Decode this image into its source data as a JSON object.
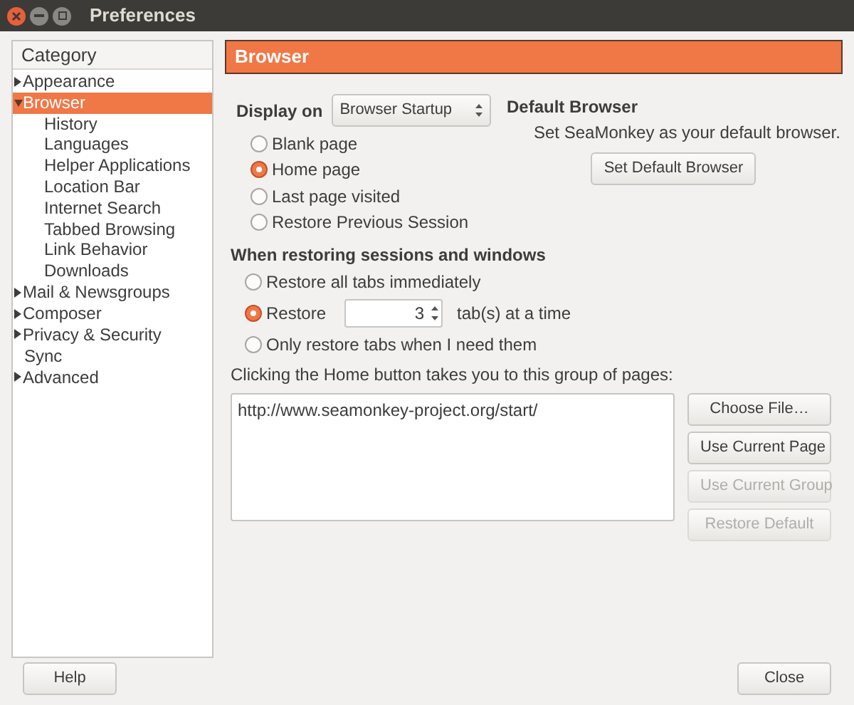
{
  "window": {
    "title": "Preferences"
  },
  "sidebar": {
    "header": "Category",
    "items": [
      {
        "label": "Appearance",
        "expandable": true,
        "expanded": false,
        "selected": false
      },
      {
        "label": "Browser",
        "expandable": true,
        "expanded": true,
        "selected": true,
        "children": [
          {
            "label": "History",
            "selected": false
          },
          {
            "label": "Languages",
            "selected": false
          },
          {
            "label": "Helper Applications",
            "selected": false
          },
          {
            "label": "Location Bar",
            "selected": false
          },
          {
            "label": "Internet Search",
            "selected": false
          },
          {
            "label": "Tabbed Browsing",
            "selected": false
          },
          {
            "label": "Link Behavior",
            "selected": false
          },
          {
            "label": "Downloads",
            "selected": false
          }
        ]
      },
      {
        "label": "Mail & Newsgroups",
        "expandable": true,
        "expanded": false,
        "selected": false
      },
      {
        "label": "Composer",
        "expandable": true,
        "expanded": false,
        "selected": false
      },
      {
        "label": "Privacy & Security",
        "expandable": true,
        "expanded": false,
        "selected": false
      },
      {
        "label": "Sync",
        "expandable": false,
        "selected": false
      },
      {
        "label": "Advanced",
        "expandable": true,
        "expanded": false,
        "selected": false
      }
    ]
  },
  "panel": {
    "title": "Browser",
    "display_on": {
      "label": "Display on",
      "value": "Browser Startup"
    },
    "startup_options": [
      {
        "label": "Blank page",
        "selected": false
      },
      {
        "label": "Home page",
        "selected": true
      },
      {
        "label": "Last page visited",
        "selected": false
      },
      {
        "label": "Restore Previous Session",
        "selected": false
      }
    ],
    "default_browser": {
      "heading": "Default Browser",
      "text": "Set SeaMonkey as your default browser.",
      "button": "Set Default Browser"
    },
    "restore_heading": "When restoring sessions and windows",
    "restore_options": [
      {
        "kind": "plain",
        "label": "Restore all tabs immediately",
        "selected": false
      },
      {
        "kind": "spin",
        "label": "Restore",
        "value": "3",
        "suffix": "tab(s) at a time",
        "selected": true
      },
      {
        "kind": "plain",
        "label": "Only restore tabs when I need them",
        "selected": false
      }
    ],
    "home_label": "Clicking the Home button takes you to this group of pages:",
    "home_pages": "http://www.seamonkey-project.org/start/",
    "home_buttons": [
      {
        "label": "Choose File…",
        "disabled": false
      },
      {
        "label": "Use Current Page",
        "disabled": false
      },
      {
        "label": "Use Current Group",
        "disabled": true
      },
      {
        "label": "Restore Default",
        "disabled": true
      }
    ]
  },
  "buttons": [
    {
      "label": "Help"
    },
    {
      "label": "Close"
    }
  ]
}
